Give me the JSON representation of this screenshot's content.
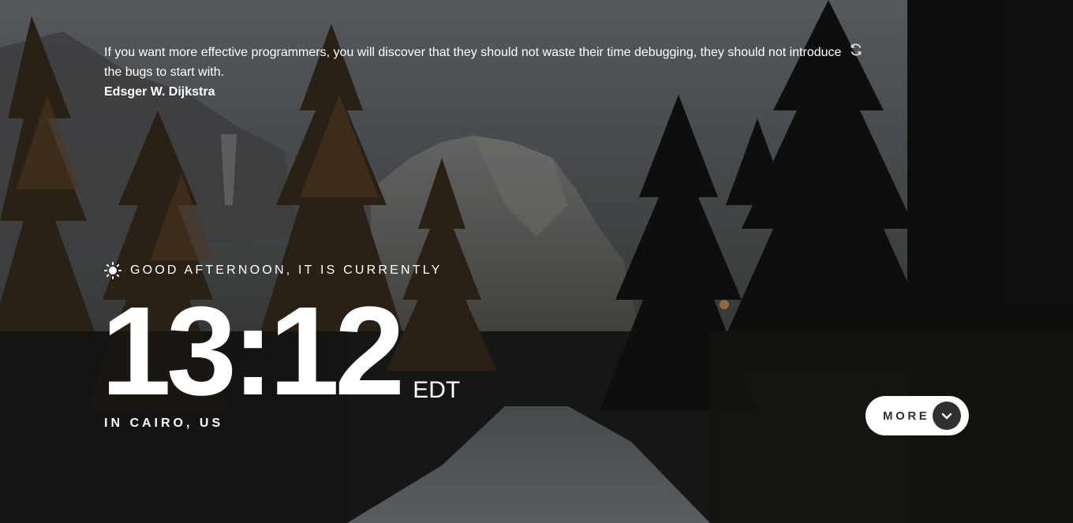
{
  "quote": {
    "text": "If you want more effective programmers, you will discover that they should not waste their time debugging, they should not introduce the bugs to start with.",
    "author": "Edsger W. Dijkstra",
    "refresh_icon": "refresh-icon"
  },
  "greeting": {
    "icon": "sun-icon",
    "text": "GOOD AFTERNOON, IT IS CURRENTLY"
  },
  "clock": {
    "time": "13:12",
    "timezone": "EDT",
    "location": "IN CAIRO, US"
  },
  "more_button": {
    "label": "MORE",
    "icon": "chevron-down-icon"
  }
}
